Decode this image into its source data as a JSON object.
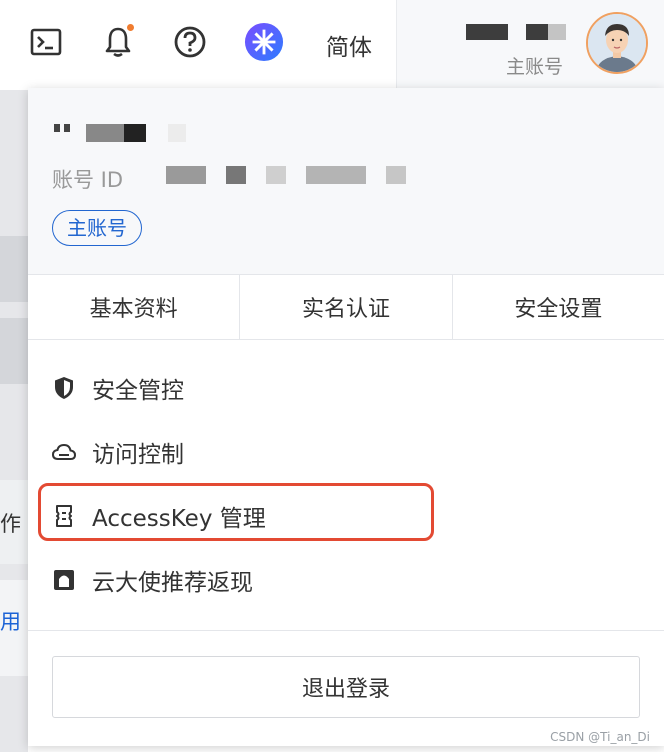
{
  "topbar": {
    "icons": [
      "terminal-icon",
      "bell-icon",
      "help-icon",
      "cloud-logo-icon"
    ],
    "language": "简体",
    "account_role": "主账号"
  },
  "background_page": {
    "text_1": "作",
    "text_2": "用"
  },
  "dropdown": {
    "account_id_label": "账号 ID",
    "account_type_badge": "主账号",
    "tabs": [
      {
        "label": "基本资料"
      },
      {
        "label": "实名认证"
      },
      {
        "label": "安全设置"
      }
    ],
    "menu": [
      {
        "label": "安全管控",
        "icon": "shield-icon"
      },
      {
        "label": "访问控制",
        "icon": "cloud-icon"
      },
      {
        "label": "AccessKey 管理",
        "icon": "key-icon"
      },
      {
        "label": "云大使推荐返现",
        "icon": "ambassador-icon"
      }
    ],
    "logout_label": "退出登录"
  },
  "colors": {
    "accent": "#2266d0",
    "highlight": "#e34a33",
    "notification_dot": "#f07c2f",
    "avatar_border": "#f0a060"
  },
  "watermark": "CSDN @Ti_an_Di"
}
